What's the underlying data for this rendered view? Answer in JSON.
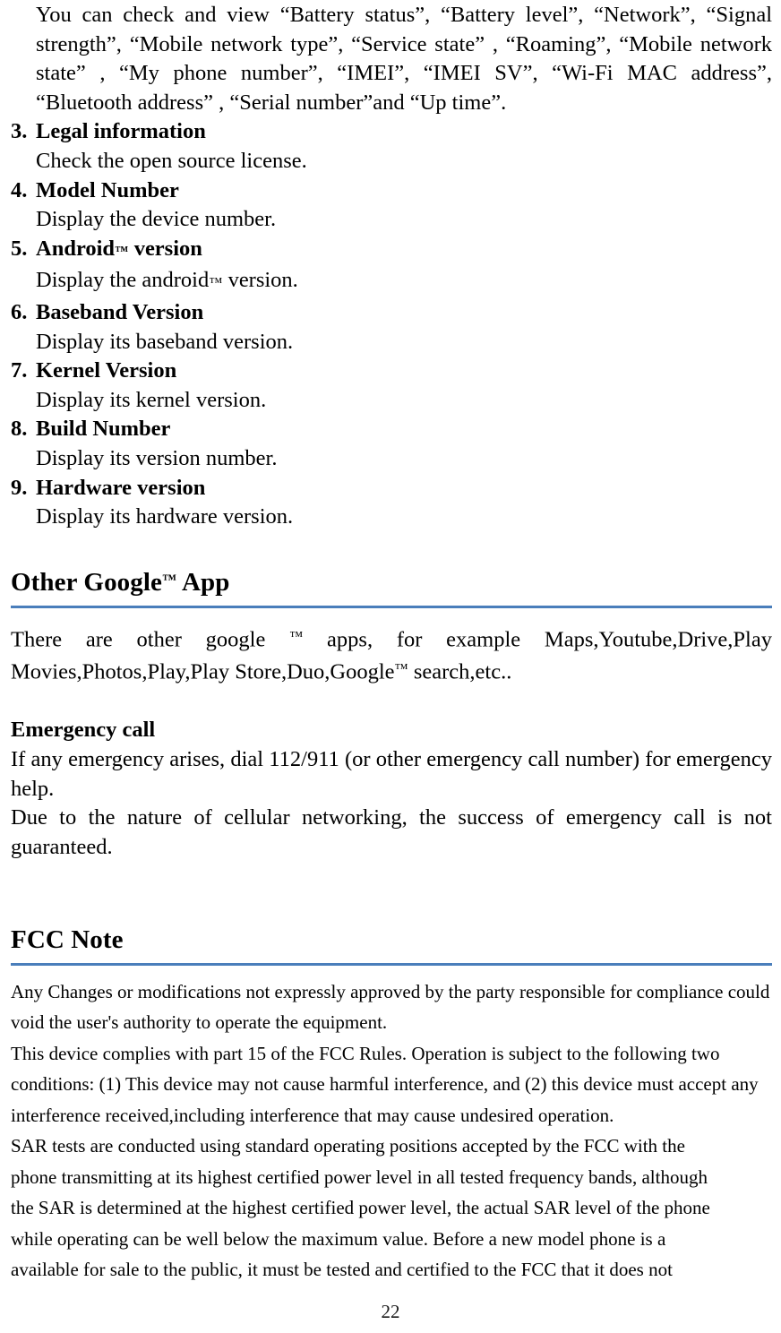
{
  "document": {
    "page_number": "22",
    "accent_rule_color": "#4a7ebb"
  },
  "top_paragraph": {
    "text": "You can check and view “Battery status”, “Battery level”, “Network”, “Signal strength”, “Mobile network type”, “Service state” , “Roaming”, “Mobile network state” , “My phone number”,    “IMEI”, “IMEI SV”, “Wi-Fi MAC address”, “Bluetooth address” , “Serial number”and “Up time”."
  },
  "list": {
    "items": [
      {
        "number": "3.",
        "title": "Legal information",
        "title_suffix": "",
        "description": "Check the open source license."
      },
      {
        "number": "4.",
        "title": "Model Number",
        "title_suffix": "",
        "description": "Display the device number."
      },
      {
        "number": "5.",
        "title": "Android",
        "title_tm": "™",
        "title_suffix": " version",
        "description_pre": "Display the android",
        "description_tm": "™",
        "description_post": " version."
      },
      {
        "number": "6.",
        "title": "Baseband Version",
        "title_suffix": "",
        "description": "Display its baseband version."
      },
      {
        "number": "7.",
        "title": "Kernel Version",
        "title_suffix": "",
        "description": "Display its kernel version."
      },
      {
        "number": "8.",
        "title": "Build Number",
        "title_suffix": "",
        "description": "Display its version number."
      },
      {
        "number": "9.",
        "title": "Hardware version",
        "title_suffix": "",
        "description": "Display its hardware version."
      }
    ]
  },
  "google_app_section": {
    "heading_pre": "Other Google",
    "heading_tm": "™",
    "heading_post": " App",
    "body_pre": "There are other google ",
    "body_tm1": "™",
    "body_mid": " apps, for example  Maps,Youtube,Drive,Play Movies,Photos,Play,Play Store,Duo,Google",
    "body_tm2": "™",
    "body_post": " search,etc.."
  },
  "emergency_section": {
    "heading": "Emergency call",
    "paragraph_1": "If any emergency arises, dial 112/911 (or other emergency call number) for emergency help.",
    "paragraph_2": "Due to the nature of cellular networking, the success of emergency call is not guaranteed."
  },
  "fcc_section": {
    "heading": "FCC Note",
    "lines": [
      "Any Changes or modifications not expressly approved by the party responsible for compliance could",
      "void the user's authority to operate the equipment.",
      "This device complies with part 15 of the FCC Rules. Operation is subject to the following two",
      "conditions: (1) This device may not cause harmful interference, and (2) this device must accept any",
      "interference received,including interference that may cause undesired operation."
    ],
    "sar_lines": [
      "SAR tests are conducted using standard operating positions accepted by the FCC with the",
      "phone transmitting at its highest certified power level in all tested frequency bands, although",
      "the SAR is determined at the highest certified power level, the actual SAR level of the phone",
      "while operating can be well below the maximum value. Before a new model phone is a",
      "available for sale to the public, it must be tested and certified to the FCC that it does not"
    ]
  }
}
